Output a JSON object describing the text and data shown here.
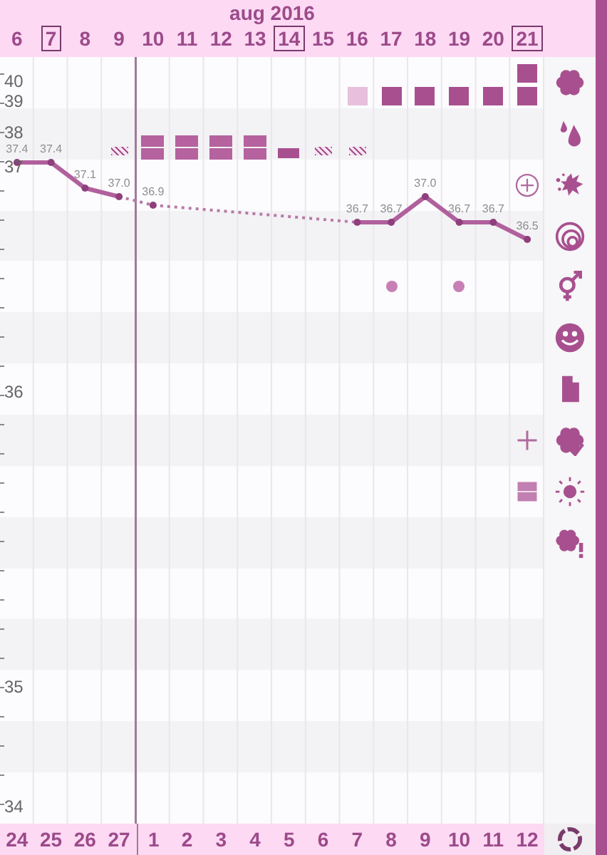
{
  "title": "aug 2016",
  "y_axis": [
    "40",
    "39",
    "38",
    "37",
    "36",
    "35",
    "34"
  ],
  "days": [
    {
      "date": "6",
      "boxed": false,
      "cycle_day": "24",
      "temp": "37.4"
    },
    {
      "date": "7",
      "boxed": true,
      "cycle_day": "25",
      "temp": "37.4"
    },
    {
      "date": "8",
      "boxed": false,
      "cycle_day": "26",
      "temp": "37.1"
    },
    {
      "date": "9",
      "boxed": false,
      "cycle_day": "27",
      "temp": "37.0",
      "bleeding": {
        "kind": "spotting"
      }
    },
    {
      "date": "10",
      "boxed": false,
      "cycle_day": "1",
      "temp": "36.9",
      "bleeding": {
        "kind": "heavy"
      },
      "cycle_start": true
    },
    {
      "date": "11",
      "boxed": false,
      "cycle_day": "2",
      "bleeding": {
        "kind": "heavy"
      }
    },
    {
      "date": "12",
      "boxed": false,
      "cycle_day": "3",
      "bleeding": {
        "kind": "heavy"
      }
    },
    {
      "date": "13",
      "boxed": false,
      "cycle_day": "4",
      "bleeding": {
        "kind": "heavy"
      }
    },
    {
      "date": "14",
      "boxed": true,
      "cycle_day": "5",
      "bleeding": {
        "kind": "medium"
      }
    },
    {
      "date": "15",
      "boxed": false,
      "cycle_day": "6",
      "bleeding": {
        "kind": "spotting"
      }
    },
    {
      "date": "16",
      "boxed": false,
      "cycle_day": "7",
      "temp": "36.7",
      "bleeding": {
        "kind": "spotting"
      },
      "mucus": {
        "kind": "pale"
      }
    },
    {
      "date": "17",
      "boxed": false,
      "cycle_day": "8",
      "temp": "36.7",
      "mucus": {
        "kind": "strong"
      },
      "sex": true
    },
    {
      "date": "18",
      "boxed": false,
      "cycle_day": "9",
      "temp": "37.0",
      "mucus": {
        "kind": "strong"
      }
    },
    {
      "date": "19",
      "boxed": false,
      "cycle_day": "10",
      "temp": "36.7",
      "mucus": {
        "kind": "strong"
      },
      "sex": true
    },
    {
      "date": "20",
      "boxed": false,
      "cycle_day": "11",
      "temp": "36.7",
      "mucus": {
        "kind": "strong"
      }
    },
    {
      "date": "21",
      "boxed": true,
      "cycle_day": "12",
      "temp": "36.5",
      "mucus": {
        "kind": "double"
      }
    }
  ]
}
